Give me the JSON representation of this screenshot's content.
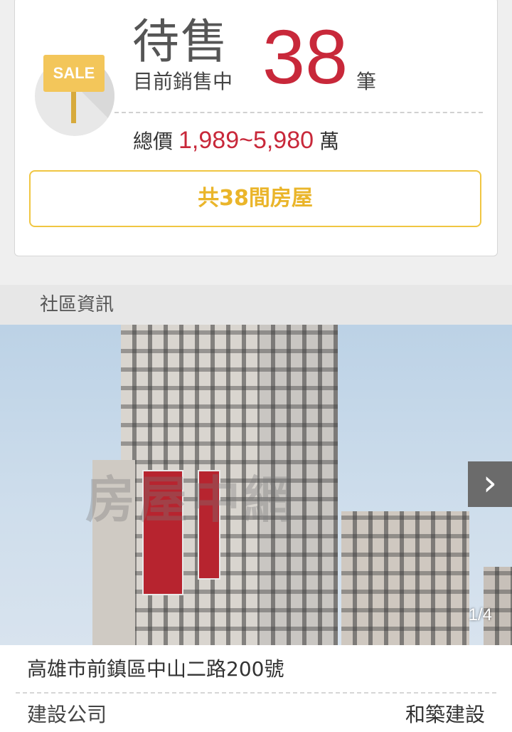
{
  "summary": {
    "status_title": "待售",
    "status_subtitle": "目前銷售中",
    "count": "38",
    "count_unit": "筆",
    "sale_sign": "SALE",
    "price_label": "總價",
    "price_range": "1,989~5,980",
    "price_unit": "萬",
    "houses_button_label": "共38間房屋"
  },
  "community": {
    "section_title": "社區資訊",
    "watermark": "房屋中網",
    "gallery_counter": "1/4",
    "address": "高雄市前鎮區中山二路200號",
    "builder_label": "建設公司",
    "builder_value": "和築建設"
  },
  "colors": {
    "accent_red": "#c8283a",
    "button_yellow": "#eab52a"
  }
}
